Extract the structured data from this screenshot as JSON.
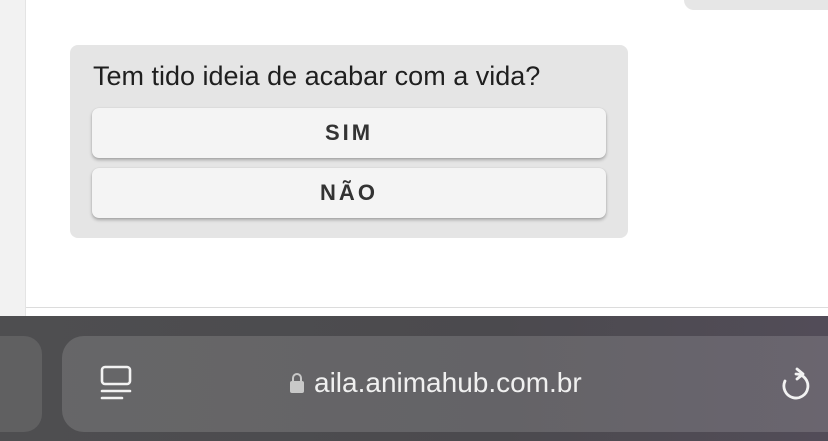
{
  "chat": {
    "question": "Tem tido ideia de acabar com a vida?",
    "options": [
      {
        "label": "SIM"
      },
      {
        "label": "NÃO"
      }
    ]
  },
  "browser": {
    "url": "aila.animahub.com.br",
    "icons": {
      "reader": "reader-mode-icon",
      "lock": "lock-icon",
      "reload": "reload-icon"
    }
  },
  "colors": {
    "bubble_bg": "#e5e5e5",
    "button_bg": "#f4f4f4",
    "text": "#1f1f1f",
    "browser_bar": "#4e4e50"
  }
}
